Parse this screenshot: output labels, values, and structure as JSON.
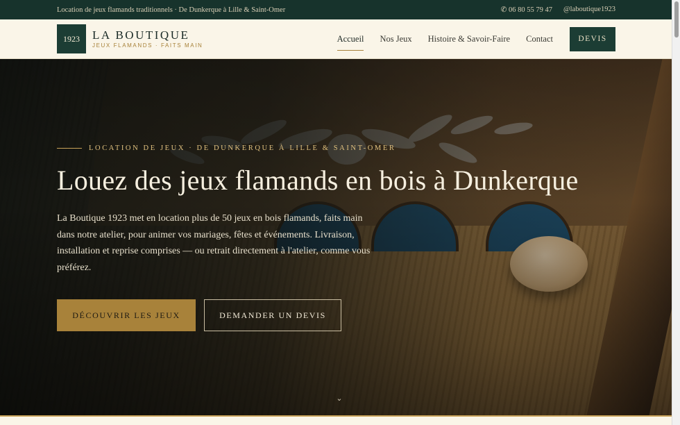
{
  "topbar": {
    "tagline": "Location de jeux flamands traditionnels · De Dunkerque à Lille & Saint-Omer",
    "phone": "✆ 06 80 55 79 47",
    "social": "@laboutique1923"
  },
  "header": {
    "logo_year": "1923",
    "brand_name": "LA BOUTIQUE",
    "brand_tagline": "JEUX FLAMANDS · FAITS MAIN",
    "nav": [
      "Accueil",
      "Nos Jeux",
      "Histoire & Savoir-Faire",
      "Contact"
    ],
    "devis_label": "DEVIS"
  },
  "hero": {
    "eyebrow": "LOCATION DE JEUX · DE DUNKERQUE À LILLE & SAINT-OMER",
    "title": "Louez des jeux flamands en bois à Dunkerque",
    "lead": "La Boutique 1923 met en location plus de 50 jeux en bois flamands, faits main dans notre atelier, pour animer vos mariages, fêtes et événements. Livraison, installation et reprise comprises — ou retrait directement à l'atelier, comme vous préférez.",
    "cta_primary": "DÉCOUVRIR LES JEUX",
    "cta_secondary": "DEMANDER UN DEVIS",
    "scroll_glyph": "⌄"
  },
  "colors": {
    "dark_green": "#1c3d34",
    "gold": "#a8823a",
    "cream": "#faf5e8"
  }
}
